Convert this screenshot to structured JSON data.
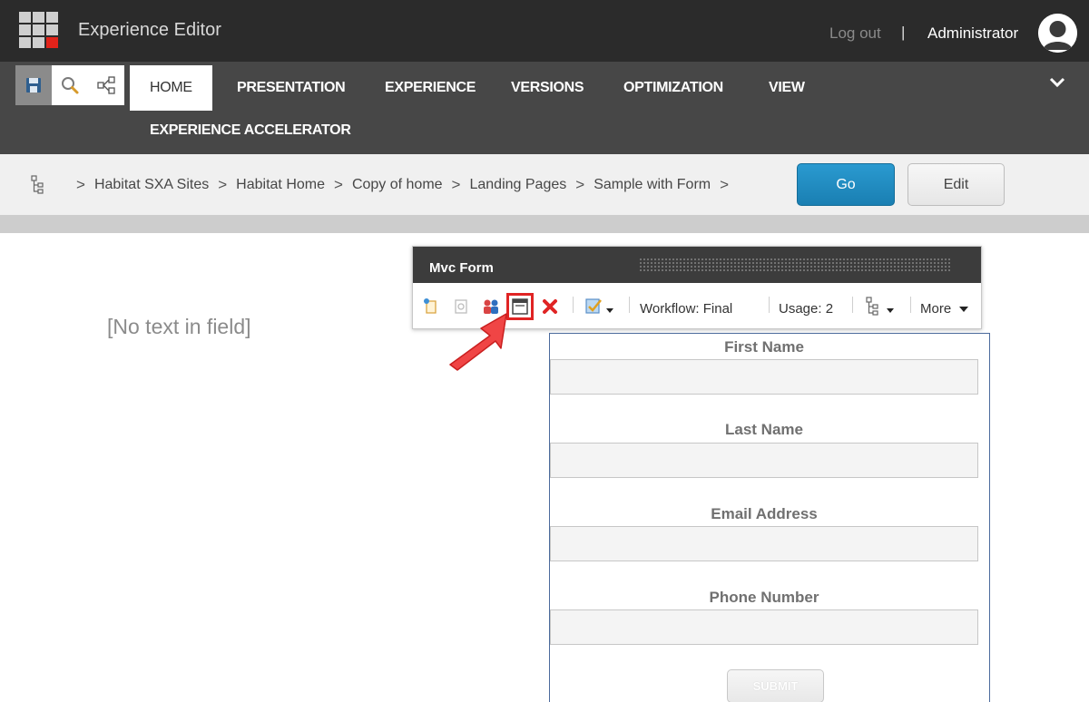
{
  "header": {
    "app_title": "Experience Editor",
    "logout_label": "Log out",
    "separator": "|",
    "user_name": "Administrator"
  },
  "ribbon": {
    "quick_actions": [
      {
        "icon": "save-icon"
      },
      {
        "icon": "search-icon"
      },
      {
        "icon": "share-icon"
      }
    ],
    "tabs": [
      {
        "label": "HOME",
        "active": true
      },
      {
        "label": "PRESENTATION"
      },
      {
        "label": "EXPERIENCE"
      },
      {
        "label": "VERSIONS"
      },
      {
        "label": "OPTIMIZATION"
      },
      {
        "label": "VIEW"
      },
      {
        "label": "EXPERIENCE ACCELERATOR"
      }
    ],
    "collapse_icon": "chevron-down-icon"
  },
  "breadcrumb": {
    "tree_icon": "tree-icon",
    "items": [
      "Habitat SXA Sites",
      "Habitat Home",
      "Copy of home",
      "Landing Pages",
      "Sample with Form"
    ],
    "separator": ">",
    "go_label": "Go",
    "edit_label": "Edit"
  },
  "content": {
    "empty_field_text": "[No text in field]"
  },
  "chrome": {
    "title": "Mvc Form",
    "icons": [
      "insert-icon",
      "edit-related-item-icon",
      "personalize-icon",
      "change-layout-icon",
      "delete-icon",
      "workflow-icon",
      "tree-icon"
    ],
    "highlighted_icon": "change-layout-icon",
    "workflow_label": "Workflow: Final",
    "usage_label": "Usage: 2",
    "more_label": "More"
  },
  "form": {
    "fields": [
      {
        "label": "First Name",
        "value": ""
      },
      {
        "label": "Last Name",
        "value": ""
      },
      {
        "label": "Email Address",
        "value": ""
      },
      {
        "label": "Phone Number",
        "value": ""
      }
    ],
    "submit_label": "SUBMIT"
  },
  "colors": {
    "accent_blue": "#1a8cc4",
    "highlight_red": "#e02424",
    "topbar": "#2b2b2b",
    "ribbon": "#474747"
  }
}
